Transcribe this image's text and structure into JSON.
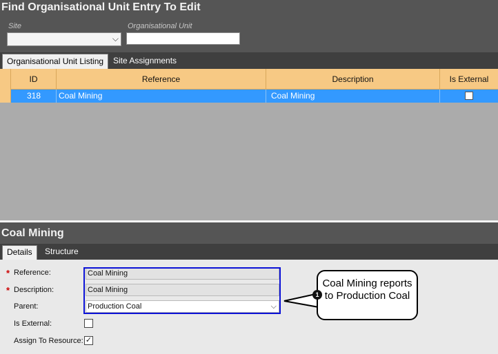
{
  "find_panel": {
    "title": "Find Organisational Unit Entry To Edit",
    "site_label": "Site",
    "site_value": "",
    "org_unit_label": "Organisational Unit",
    "org_unit_value": ""
  },
  "listing_tabs": [
    {
      "label": "Organisational Unit Listing",
      "active": true
    },
    {
      "label": "Site Assignments",
      "active": false
    }
  ],
  "grid": {
    "columns": [
      "ID",
      "Reference",
      "Description",
      "Is External"
    ],
    "rows": [
      {
        "id": "318",
        "reference": "Coal Mining",
        "description": "Coal Mining",
        "is_external": false
      }
    ]
  },
  "detail": {
    "title": "Coal Mining",
    "tabs": [
      {
        "label": "Details",
        "active": true
      },
      {
        "label": "Structure",
        "active": false
      }
    ],
    "fields": {
      "reference_label": "Reference:",
      "reference_value": "Coal Mining",
      "description_label": "Description:",
      "description_value": "Coal Mining",
      "parent_label": "Parent:",
      "parent_value": "Production Coal",
      "is_external_label": "Is External:",
      "is_external_checked": false,
      "assign_label": "Assign To Resource:",
      "assign_checked": true
    }
  },
  "callout": {
    "badge": "1",
    "text": "Coal Mining reports to Production Coal"
  },
  "colors": {
    "header_bg": "#555555",
    "grid_header": "#f7c984",
    "selected_row": "#3399ff",
    "highlight_box": "#0b11d6"
  }
}
